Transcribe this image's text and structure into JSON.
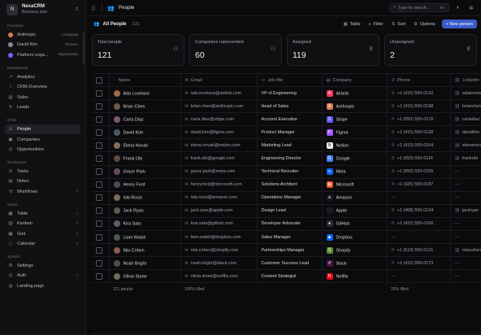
{
  "brand": {
    "name": "NexaCRM",
    "plan": "Business plan"
  },
  "sidebar": {
    "favorites_title": "Favorites",
    "favorites": [
      {
        "label": "Anthropic",
        "meta": "Company",
        "color": "#d97757"
      },
      {
        "label": "David Kim",
        "meta": "Person",
        "color": "#8a8a93"
      },
      {
        "label": "Platform expa...",
        "meta": "Opportunity",
        "color": "#7b5cff"
      }
    ],
    "dashboards_title": "Dashboards",
    "dashboards": [
      {
        "label": "Analytics"
      },
      {
        "label": "CRM Overview"
      },
      {
        "label": "Sales"
      },
      {
        "label": "Leads"
      }
    ],
    "crm_title": "CRM",
    "crm": [
      {
        "label": "People"
      },
      {
        "label": "Companies"
      },
      {
        "label": "Opportunities"
      }
    ],
    "workspace_title": "Workspace",
    "workspace": [
      {
        "label": "Tasks"
      },
      {
        "label": "Notes"
      },
      {
        "label": "Workflows"
      }
    ],
    "views_title": "Views",
    "views": [
      {
        "label": "Table"
      },
      {
        "label": "Kanban"
      },
      {
        "label": "Grid"
      },
      {
        "label": "Calendar"
      }
    ],
    "system_title": "System",
    "system": [
      {
        "label": "Settings"
      },
      {
        "label": "Auth"
      },
      {
        "label": "Landing page"
      }
    ]
  },
  "topbar": {
    "title": "People",
    "search_placeholder": "Type to search...",
    "search_kbd": "⌘K"
  },
  "subbar": {
    "title": "All People",
    "count": "· 121",
    "table": "Table",
    "filter": "Filter",
    "sort": "Sort",
    "options": "Options",
    "new": "+ New person"
  },
  "stats": [
    {
      "label": "Total people",
      "value": "121",
      "icon": "users-icon"
    },
    {
      "label": "Companies represented",
      "value": "60",
      "icon": "users-icon"
    },
    {
      "label": "Assigned",
      "value": "119",
      "icon": "user-check-icon"
    },
    {
      "label": "Unassigned",
      "value": "2",
      "icon": "user-x-icon"
    }
  ],
  "table": {
    "columns": [
      "Name",
      "Email",
      "Job title",
      "Company",
      "Phone",
      "LinkedIn"
    ],
    "rows": [
      {
        "name": "Ada Lovelace",
        "email": "ada.lovelace@airbnb.com",
        "job": "VP of Engineering",
        "company": "Airbnb",
        "logo_color": "#ff385c",
        "logo_char": "A",
        "phone": "+1 (415) 555-0142",
        "linkedin": "adalovelace",
        "avatar_color": "#9a6b4b"
      },
      {
        "name": "Brian Chen",
        "email": "brian.chen@anthropic.com",
        "job": "Head of Sales",
        "company": "Anthropic",
        "logo_color": "#d97757",
        "logo_char": "A",
        "phone": "+1 (415) 555-0198",
        "linkedin": "brianchen",
        "avatar_color": "#6b5a4a"
      },
      {
        "name": "Carla Diaz",
        "email": "carla.diaz@stripe.com",
        "job": "Account Executive",
        "company": "Stripe",
        "logo_color": "#635bff",
        "logo_char": "S",
        "phone": "+1 (650) 555-0176",
        "linkedin": "carladiaz",
        "avatar_color": "#7a5b6b"
      },
      {
        "name": "David Kim",
        "email": "david.kim@figma.com",
        "job": "Product Manager",
        "company": "Figma",
        "logo_color": "#a259ff",
        "logo_char": "F",
        "phone": "+1 (415) 555-0128",
        "linkedin": "davidkim",
        "avatar_color": "#4b5a6b"
      },
      {
        "name": "Elena Novak",
        "email": "elena.novak@notion.com",
        "job": "Marketing Lead",
        "company": "Notion",
        "logo_color": "#ededed",
        "logo_char": "N",
        "phone": "+1 (415) 555-0164",
        "linkedin": "elenanovak",
        "avatar_color": "#8a6b5a"
      },
      {
        "name": "Frank Obi",
        "email": "frank.obi@google.com",
        "job": "Engineering Director",
        "company": "Google",
        "logo_color": "#4285f4",
        "logo_char": "G",
        "phone": "+1 (650) 555-0114",
        "linkedin": "frankobi",
        "avatar_color": "#5a4b3c"
      },
      {
        "name": "Grace Park",
        "email": "grace.park@meta.com",
        "job": "Technical Recruiter",
        "company": "Meta",
        "logo_color": "#0866ff",
        "logo_char": "∞",
        "phone": "+1 (650) 555-0155",
        "linkedin": "—",
        "avatar_color": "#6b4b5a"
      },
      {
        "name": "Henry Ford",
        "email": "henry.ford@microsoft.com",
        "job": "Solutions Architect",
        "company": "Microsoft",
        "logo_color": "#f25022",
        "logo_char": "▦",
        "phone": "+1 (425) 555-0187",
        "linkedin": "—",
        "avatar_color": "#4b4b5a"
      },
      {
        "name": "Isla Rossi",
        "email": "isla.rossi@amazon.com",
        "job": "Operations Manager",
        "company": "Amazon",
        "logo_color": "#1a1a1f",
        "logo_char": "a",
        "phone": "—",
        "linkedin": "—",
        "avatar_color": "#7a6b5a"
      },
      {
        "name": "Jack Ryan",
        "email": "jack.ryan@apple.com",
        "job": "Design Lead",
        "company": "Apple",
        "logo_color": "#1a1a1f",
        "logo_char": "",
        "phone": "+1 (408) 555-0134",
        "linkedin": "jackryan",
        "avatar_color": "#5a5a4b"
      },
      {
        "name": "Kira Sato",
        "email": "kira.sato@github.com",
        "job": "Developer Advocate",
        "company": "GitHub",
        "logo_color": "#2b2b31",
        "logo_char": "●",
        "phone": "+1 (415) 555-0166",
        "linkedin": "—",
        "avatar_color": "#6b5a6b"
      },
      {
        "name": "Liam Walsh",
        "email": "liam.walsh@dropbox.com",
        "job": "Sales Manager",
        "company": "Dropbox",
        "logo_color": "#0061ff",
        "logo_char": "◆",
        "phone": "—",
        "linkedin": "—",
        "avatar_color": "#4b5a4b"
      },
      {
        "name": "Mia Cohen",
        "email": "mia.cohen@shopify.com",
        "job": "Partnerships Manager",
        "company": "Shopify",
        "logo_color": "#5e8e3e",
        "logo_char": "S",
        "phone": "+1 (613) 555-0121",
        "linkedin": "miacohen",
        "avatar_color": "#8a5a4b"
      },
      {
        "name": "Noah Bright",
        "email": "noah.bright@slack.com",
        "job": "Customer Success Lead",
        "company": "Slack",
        "logo_color": "#4a154b",
        "logo_char": "#",
        "phone": "+1 (415) 555-0173",
        "linkedin": "—",
        "avatar_color": "#5a4b4b"
      },
      {
        "name": "Olivia Stone",
        "email": "olivia.stone@netflix.com",
        "job": "Content Strategist",
        "company": "Netflix",
        "logo_color": "#e50914",
        "logo_char": "N",
        "phone": "—",
        "linkedin": "—",
        "avatar_color": "#6b6b5a"
      }
    ],
    "footer": {
      "count": "121 people",
      "email_fill": "100% filled",
      "phone_fill": "26% filled"
    }
  }
}
